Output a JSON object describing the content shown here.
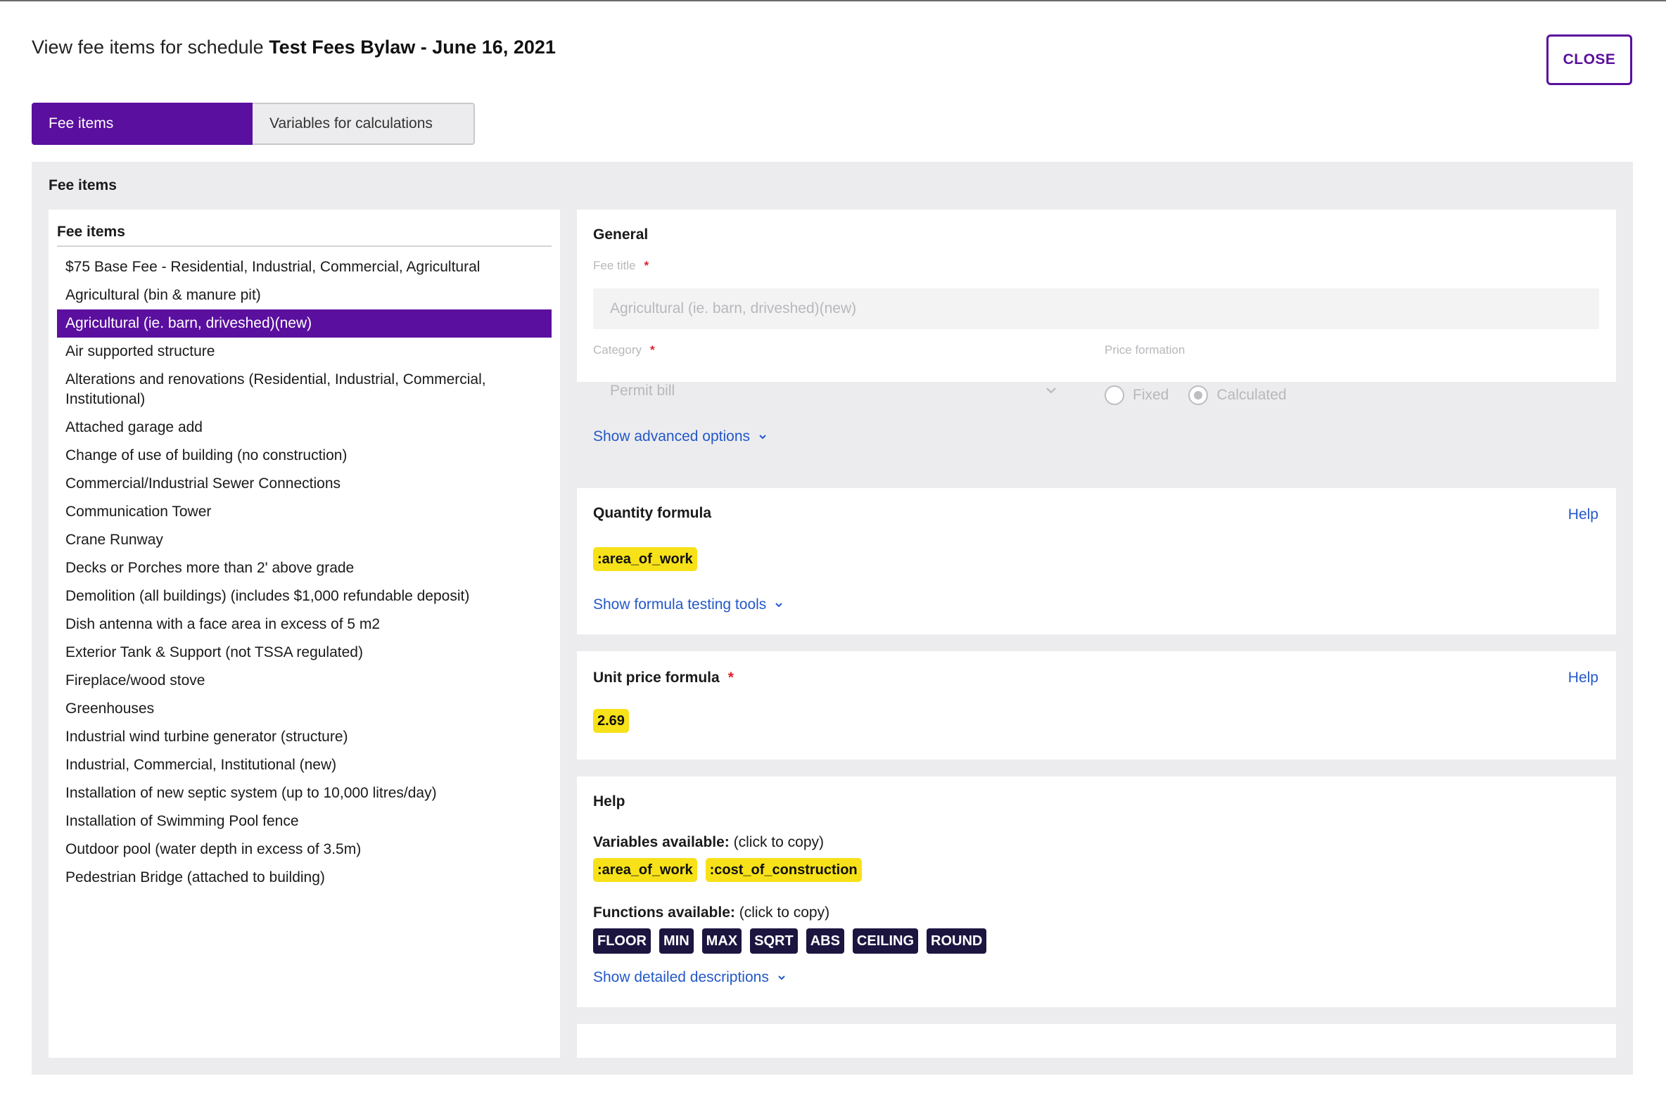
{
  "dialog": {
    "title_prefix": "View fee items for schedule",
    "title_schedule": "Test Fees Bylaw - June 16, 2021",
    "close_label": "CLOSE"
  },
  "tabs": [
    {
      "label": "Fee items",
      "active": true
    },
    {
      "label": "Variables for calculations",
      "active": false
    }
  ],
  "section_title": "Fee items",
  "fee_list": {
    "header": "Fee items",
    "selected_index": 2,
    "items": [
      "$75 Base Fee - Residential, Industrial, Commercial, Agricultural",
      "Agricultural (bin & manure pit)",
      "Agricultural (ie. barn, driveshed)(new)",
      "Air supported structure",
      "Alterations and renovations (Residential, Industrial, Commercial, Institutional)",
      "Attached garage add",
      "Change of use of building (no construction)",
      "Commercial/Industrial Sewer Connections",
      "Communication Tower",
      "Crane Runway",
      "Decks or Porches more than 2' above grade",
      "Demolition (all buildings) (includes $1,000 refundable deposit)",
      "Dish antenna with a face area in excess of 5 m2",
      "Exterior Tank & Support (not TSSA regulated)",
      "Fireplace/wood stove",
      "Greenhouses",
      "Industrial wind turbine generator (structure)",
      "Industrial, Commercial, Institutional (new)",
      "Installation of new septic system (up to 10,000 litres/day)",
      "Installation of Swimming Pool fence",
      "Outdoor pool (water depth in excess of 3.5m)",
      "Pedestrian Bridge (attached to building)"
    ]
  },
  "general": {
    "title": "General",
    "fee_title_label": "Fee title",
    "fee_title_value": "Agricultural (ie. barn, driveshed)(new)",
    "category_label": "Category",
    "category_value": "Permit bill",
    "price_formation_label": "Price formation",
    "price_options": [
      {
        "label": "Fixed",
        "selected": false
      },
      {
        "label": "Calculated",
        "selected": true
      }
    ],
    "advanced_link": "Show advanced options",
    "required_mark": "*"
  },
  "quantity": {
    "title": "Quantity formula",
    "help_label": "Help",
    "formula": ":area_of_work",
    "testing_link": "Show formula testing tools"
  },
  "unit_price": {
    "title": "Unit price formula",
    "help_label": "Help",
    "formula": "2.69",
    "required_mark": "*"
  },
  "help": {
    "title": "Help",
    "variables_label": "Variables available:",
    "variables_hint": " (click to copy)",
    "variables": [
      ":area_of_work",
      ":cost_of_construction"
    ],
    "functions_label": "Functions available:",
    "functions_hint": " (click to copy)",
    "functions": [
      "FLOOR",
      "MIN",
      "MAX",
      "SQRT",
      "ABS",
      "CEILING",
      "ROUND"
    ],
    "descriptions_link": "Show detailed descriptions"
  },
  "colors": {
    "accent": "#5a0f9e",
    "link": "#2358c8",
    "chip_yellow": "#f7e118",
    "chip_dark": "#1c1540",
    "required": "#e0202b"
  }
}
